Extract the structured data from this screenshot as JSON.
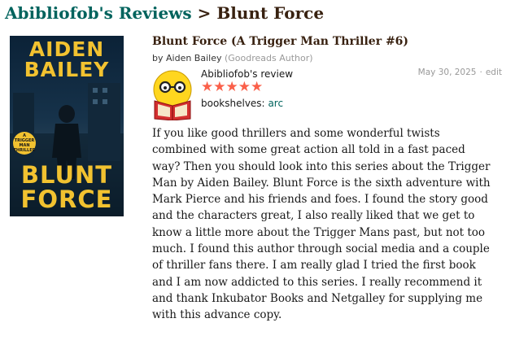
{
  "header": {
    "owner": "Abibliofob's Reviews",
    "separator": ">",
    "book_title": "Blunt Force"
  },
  "cover": {
    "author_lines": [
      "AIDEN",
      "BAILEY"
    ],
    "title_lines": [
      "BLUNT",
      "FORCE"
    ],
    "badge": "A TRIGGER MAN THRILLER"
  },
  "book": {
    "full_title": "Blunt Force (A Trigger Man Thriller #6)",
    "by": "by",
    "author": "Aiden Bailey",
    "author_tag": "(Goodreads Author)"
  },
  "review": {
    "reviewer": "Abibliofob's review",
    "rating": 5,
    "stars": "★★★★★",
    "shelves_label": "bookshelves:",
    "shelf": "arc",
    "date": "May 30, 2025",
    "dot": "·",
    "edit": "edit",
    "text_lines": [
      "If you like good thrillers and some wonderful twists",
      "combined with some great action all told in a fast paced",
      "way? Then you should look into this series about the Trigger",
      "Man by Aiden Bailey. Blunt Force is the sixth adventure with",
      "Mark Pierce and his friends and foes. I found the story good",
      "and the characters great, I also really liked that we get to",
      "know a little more about the Trigger Mans past, but not too",
      "much. I found this author through social media and a couple",
      "of thriller fans there. I am really glad I tried the first book",
      "and I am now addicted to this series. I really recommend it",
      "and thank Inkubator Books and Netgalley for supplying me",
      "with this advance copy."
    ]
  },
  "colors": {
    "brand_green": "#00635d",
    "title_brown": "#382110",
    "star": "#fa604a",
    "cover_gold": "#f2c230"
  },
  "icons": {
    "avatar": "smiley-reading-book-icon"
  }
}
